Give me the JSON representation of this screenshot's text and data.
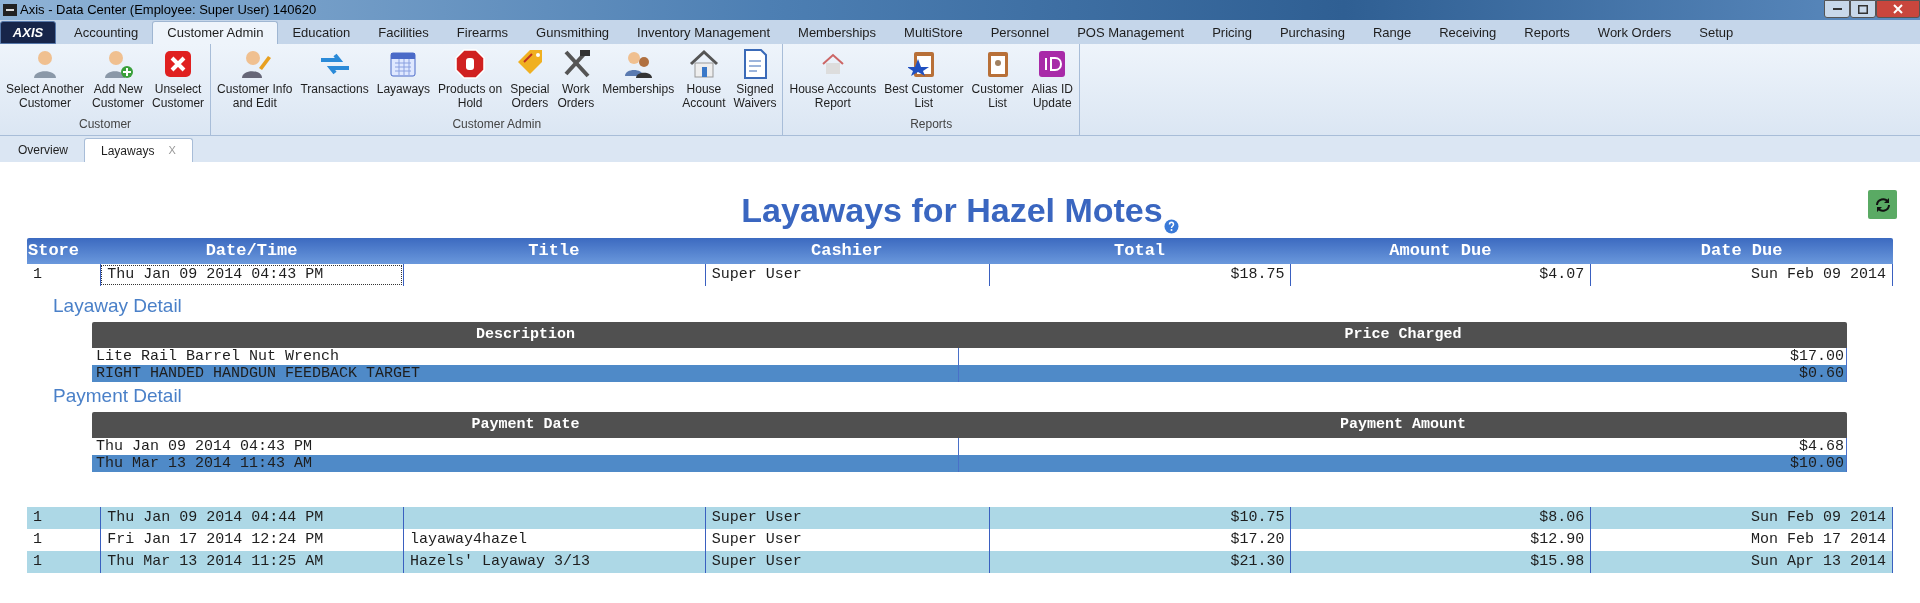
{
  "window": {
    "title": "Axis - Data Center  (Employee: Super User) 140620",
    "logo": "AXIS"
  },
  "menu_tabs": [
    {
      "label": "Accounting",
      "selected": false
    },
    {
      "label": "Customer Admin",
      "selected": true
    },
    {
      "label": "Education",
      "selected": false
    },
    {
      "label": "Facilities",
      "selected": false
    },
    {
      "label": "Firearms",
      "selected": false
    },
    {
      "label": "Gunsmithing",
      "selected": false
    },
    {
      "label": "Inventory Management",
      "selected": false
    },
    {
      "label": "Memberships",
      "selected": false
    },
    {
      "label": "MultiStore",
      "selected": false
    },
    {
      "label": "Personnel",
      "selected": false
    },
    {
      "label": "POS Management",
      "selected": false
    },
    {
      "label": "Pricing",
      "selected": false
    },
    {
      "label": "Purchasing",
      "selected": false
    },
    {
      "label": "Range",
      "selected": false
    },
    {
      "label": "Receiving",
      "selected": false
    },
    {
      "label": "Reports",
      "selected": false
    },
    {
      "label": "Work Orders",
      "selected": false
    },
    {
      "label": "Setup",
      "selected": false
    }
  ],
  "ribbon": [
    {
      "label": "Customer",
      "buttons": [
        {
          "label": "Select Another\nCustomer",
          "kind": "person"
        },
        {
          "label": "Add New\nCustomer",
          "kind": "person-add"
        },
        {
          "label": "Unselect\nCustomer",
          "kind": "remove"
        }
      ]
    },
    {
      "label": "Customer Admin",
      "buttons": [
        {
          "label": "Customer Info\nand Edit",
          "kind": "person-edit"
        },
        {
          "label": "Transactions",
          "kind": "arrows"
        },
        {
          "label": "Layaways",
          "kind": "calendar"
        },
        {
          "label": "Products on\nHold",
          "kind": "stop"
        },
        {
          "label": "Special\nOrders",
          "kind": "tag"
        },
        {
          "label": "Work\nOrders",
          "kind": "tools"
        },
        {
          "label": "Memberships",
          "kind": "people"
        },
        {
          "label": "House\nAccount",
          "kind": "house"
        },
        {
          "label": "Signed\nWaivers",
          "kind": "document"
        }
      ]
    },
    {
      "label": "Reports",
      "buttons": [
        {
          "label": "House Accounts\nReport",
          "kind": "house-small"
        },
        {
          "label": "Best Customer\nList",
          "kind": "clipboard-star"
        },
        {
          "label": "Customer\nList",
          "kind": "clipboard"
        },
        {
          "label": "Alias ID\nUpdate",
          "kind": "id"
        }
      ]
    }
  ],
  "doc_tabs": [
    {
      "label": "Overview",
      "selected": false
    },
    {
      "label": "Layaways",
      "selected": true,
      "close": "X"
    }
  ],
  "page_title": "Layaways for Hazel Motes",
  "layaways": {
    "columns": [
      "Store",
      "Date/Time",
      "Title",
      "Cashier",
      "Total",
      "Amount Due",
      "Date Due"
    ],
    "rows": [
      {
        "store": "1",
        "date_time": "Thu Jan 09 2014 04:43 PM",
        "cashier": "Super User",
        "total": "$18.75",
        "amount_due": "$4.07",
        "date_due": "Sun Feb 09 2014",
        "focused": true,
        "layaway_detail": {
          "heading": "Layaway Detail",
          "columns": [
            "Description",
            "Price Charged"
          ],
          "rows": [
            {
              "description": "Lite Rail Barrel Nut Wrench",
              "price": "$17.00",
              "selected": false
            },
            {
              "description": "RIGHT HANDED HANDGUN FEEDBACK TARGET",
              "price": "$0.60",
              "selected": true
            }
          ]
        },
        "payment_detail": {
          "heading": "Payment Detail",
          "columns": [
            "Payment Date",
            "Payment Amount"
          ],
          "rows": [
            {
              "date": "Thu Jan 09 2014 04:43 PM",
              "amount": "$4.68",
              "selected": false
            },
            {
              "date": "Thu Mar 13 2014 11:43 AM",
              "amount": "$10.00",
              "selected": true
            }
          ]
        }
      },
      {
        "store": "1",
        "date_time": "Thu Jan 09 2014 04:44 PM",
        "cashier": "Super User",
        "total": "$10.75",
        "amount_due": "$8.06",
        "date_due": "Sun Feb 09 2014",
        "focused": false
      },
      {
        "store": "1",
        "date_time": "Fri Jan 17 2014 12:24 PM",
        "title": "layaway4hazel",
        "cashier": "Super User",
        "total": "$17.20",
        "amount_due": "$12.90",
        "date_due": "Mon Feb 17 2014",
        "focused": false
      },
      {
        "store": "1",
        "date_time": "Thu Mar 13 2014 11:25 AM",
        "title": "Hazels' Layaway 3/13",
        "cashier": "Super User",
        "total": "$21.30",
        "amount_due": "$15.98",
        "date_due": "Sun Apr 13 2014",
        "focused": false
      }
    ]
  }
}
